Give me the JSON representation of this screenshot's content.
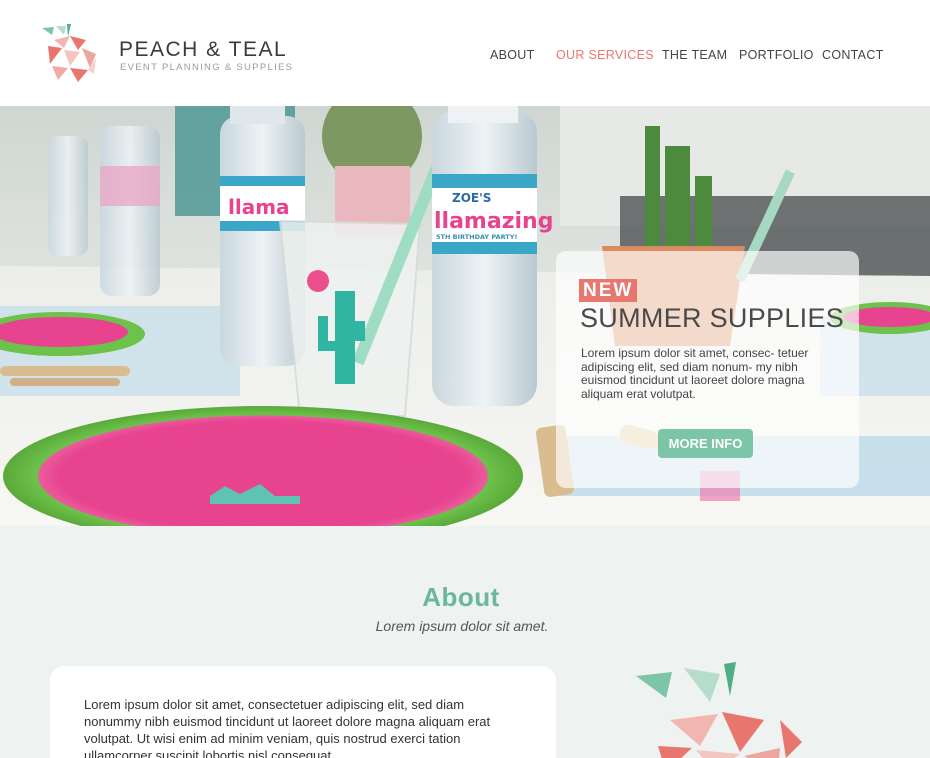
{
  "brand": {
    "name": "PEACH & TEAL",
    "tagline": "EVENT PLANNING & SUPPLIES"
  },
  "nav": {
    "items": [
      {
        "label": "ABOUT",
        "active": false
      },
      {
        "label": "OUR SERVICES",
        "active": true
      },
      {
        "label": "THE TEAM",
        "active": false
      },
      {
        "label": "PORTFOLIO",
        "active": false
      },
      {
        "label": "CONTACT",
        "active": false
      }
    ]
  },
  "hero": {
    "bottle_label_name": "ZOE'S",
    "bottle_label_title": "llamazing",
    "bottle_label_caption": "5TH BIRTHDAY PARTY!",
    "promo": {
      "badge": "NEW",
      "title": "SUMMER SUPPLIES",
      "text": "Lorem ipsum dolor sit amet, consec- tetuer adipiscing elit, sed diam nonum- my nibh euismod tincidunt ut laoreet dolore magna aliquam erat volutpat.",
      "button_label": "MORE INFO"
    }
  },
  "about": {
    "title": "About",
    "subtitle": "Lorem ipsum dolor sit amet.",
    "body": "Lorem ipsum dolor sit amet, consectetuer adipiscing elit, sed diam nonummy nibh euismod tincidunt ut laoreet dolore magna aliquam erat volutpat. Ut wisi enim ad minim veniam, quis nostrud exerci tation ullamcorper suscipit lobortis nisl consequat."
  },
  "colors": {
    "peach": "#e8766e",
    "teal": "#7cc5a6",
    "pink": "#e8438f",
    "green_plate": "#6cc24a"
  }
}
